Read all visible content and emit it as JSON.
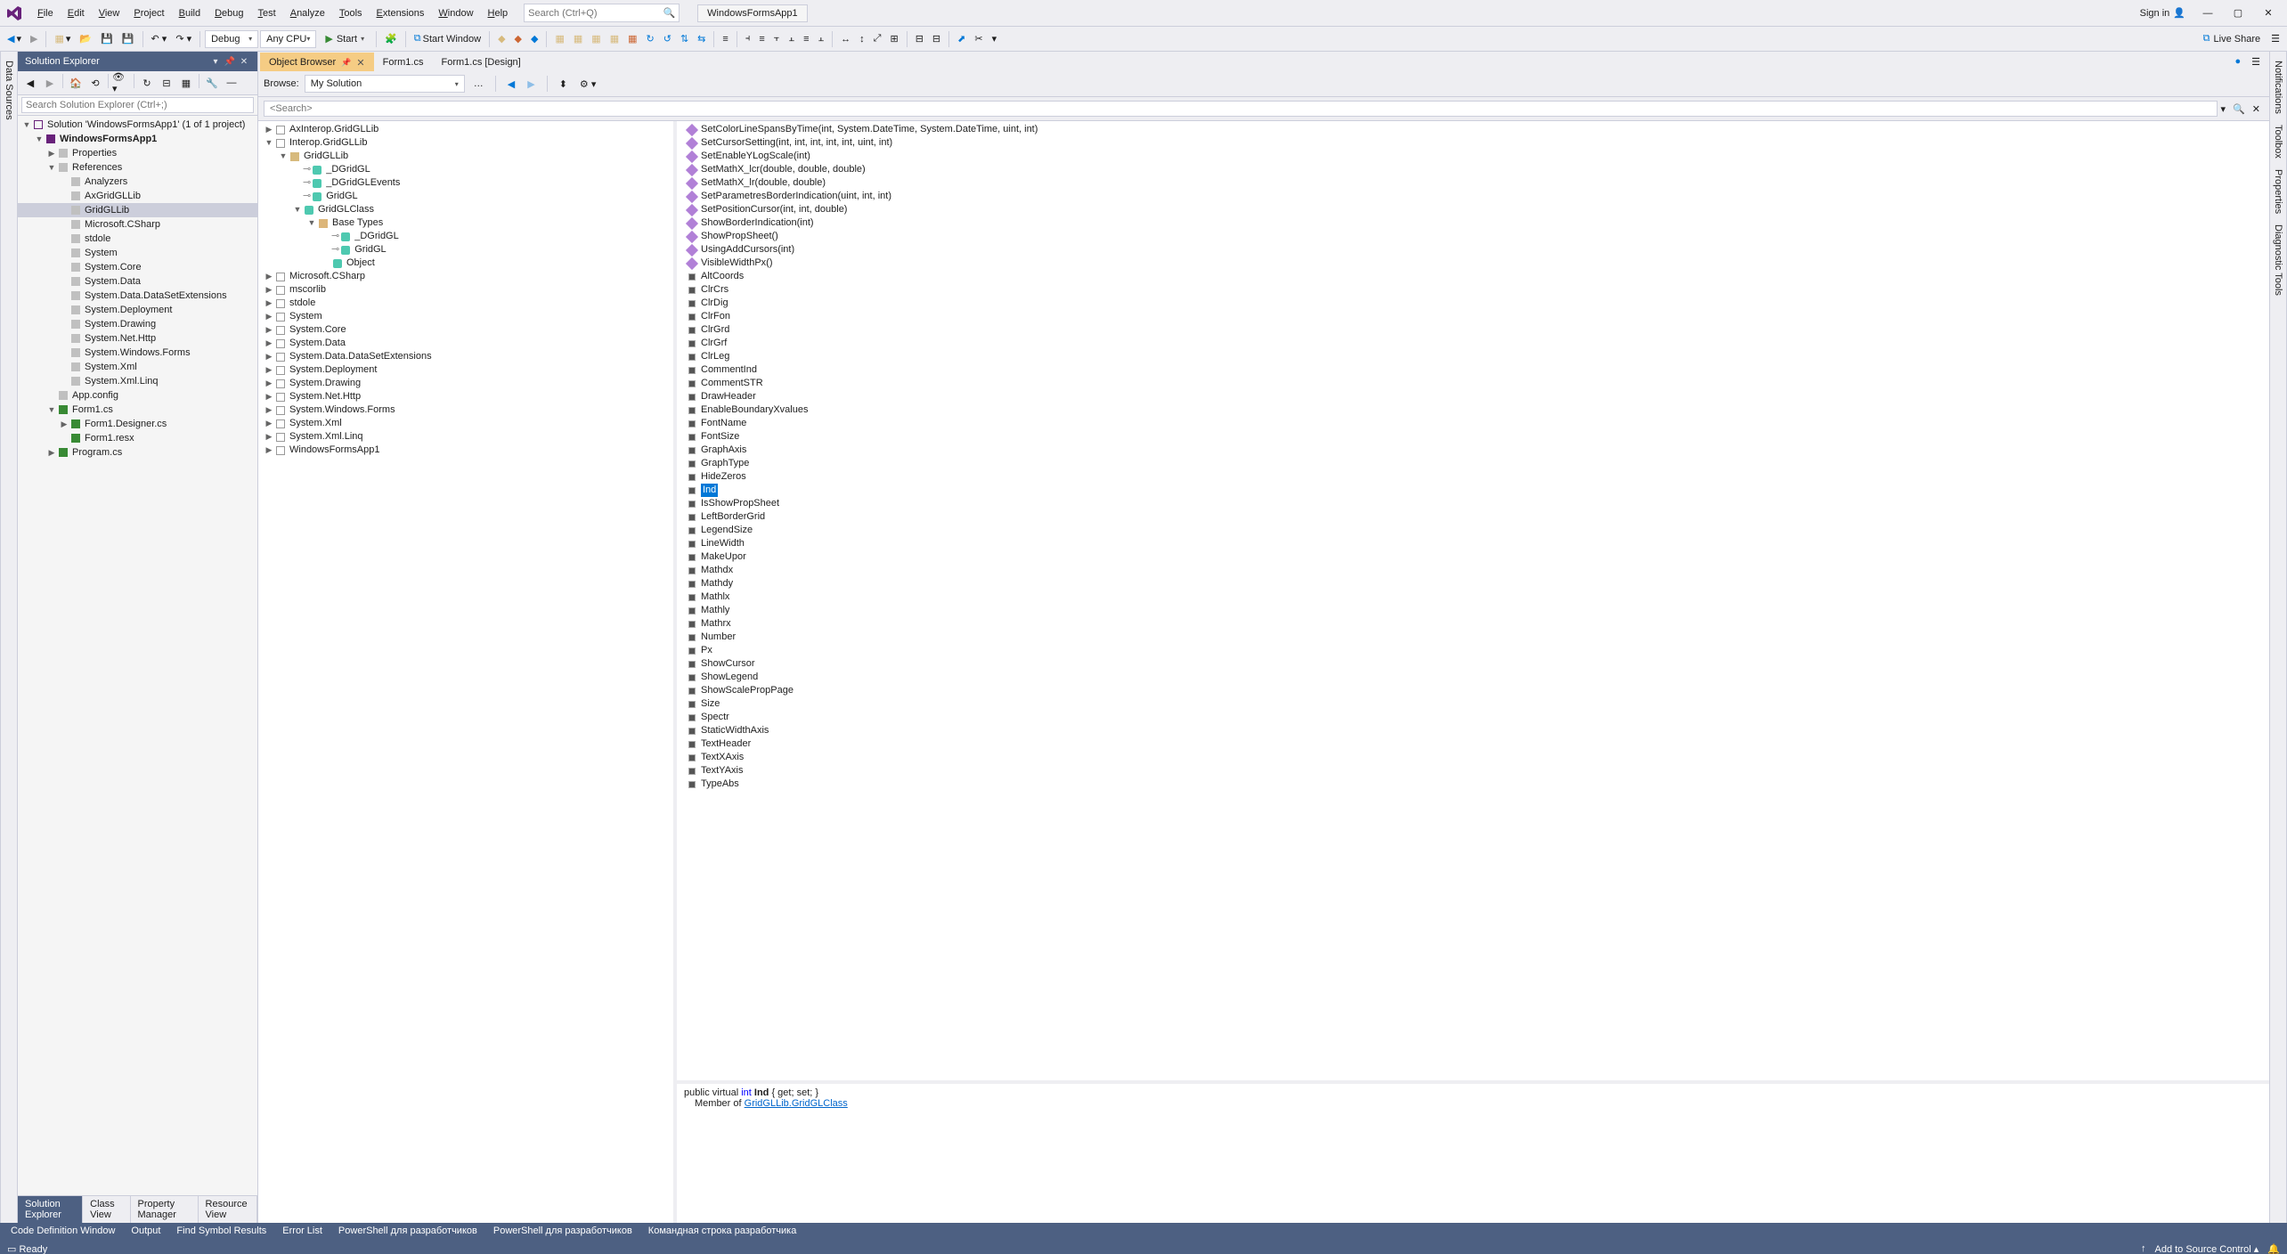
{
  "app_title": "WindowsFormsApp1",
  "menu": [
    "File",
    "Edit",
    "View",
    "Project",
    "Build",
    "Debug",
    "Test",
    "Analyze",
    "Tools",
    "Extensions",
    "Window",
    "Help"
  ],
  "search_placeholder": "Search (Ctrl+Q)",
  "signin": "Sign in",
  "toolbar": {
    "config": "Debug",
    "platform": "Any CPU",
    "start": "Start",
    "start_window": "Start Window",
    "liveshare": "Live Share"
  },
  "left_rail": [
    "Data Sources"
  ],
  "right_rail": [
    "Notifications",
    "Toolbox",
    "Properties",
    "Diagnostic Tools"
  ],
  "solution_explorer": {
    "title": "Solution Explorer",
    "search_placeholder": "Search Solution Explorer (Ctrl+;)",
    "bottom_tabs": [
      "Solution Explorer",
      "Class View",
      "Property Manager",
      "Resource View"
    ],
    "solution_label": "Solution 'WindowsFormsApp1' (1 of 1 project)",
    "project": "WindowsFormsApp1",
    "properties": "Properties",
    "references": "References",
    "refs": [
      "Analyzers",
      "AxGridGLLib",
      "GridGLLib",
      "Microsoft.CSharp",
      "stdole",
      "System",
      "System.Core",
      "System.Data",
      "System.Data.DataSetExtensions",
      "System.Deployment",
      "System.Drawing",
      "System.Net.Http",
      "System.Windows.Forms",
      "System.Xml",
      "System.Xml.Linq"
    ],
    "appconfig": "App.config",
    "form1": "Form1.cs",
    "form1_children": [
      "Form1.Designer.cs",
      "Form1.resx"
    ],
    "program": "Program.cs",
    "selected_ref": "GridGLLib"
  },
  "tabs": [
    {
      "label": "Object Browser",
      "active": true,
      "pinned": true
    },
    {
      "label": "Form1.cs",
      "active": false
    },
    {
      "label": "Form1.cs [Design]",
      "active": false
    }
  ],
  "object_browser": {
    "browse_label": "Browse:",
    "browse_value": "My Solution",
    "search_placeholder": "<Search>",
    "left_tree": {
      "top": [
        {
          "label": "AxInterop.GridGLLib",
          "depth": 0,
          "tw": "▶",
          "icon": "asm"
        },
        {
          "label": "Interop.GridGLLib",
          "depth": 0,
          "tw": "▼",
          "icon": "asm"
        },
        {
          "label": "GridGLLib",
          "depth": 1,
          "tw": "▼",
          "icon": "ns"
        },
        {
          "label": "_DGridGL",
          "depth": 2,
          "tw": "",
          "icon": "class",
          "pre": "⊸"
        },
        {
          "label": "_DGridGLEvents",
          "depth": 2,
          "tw": "",
          "icon": "class",
          "pre": "⊸"
        },
        {
          "label": "GridGL",
          "depth": 2,
          "tw": "",
          "icon": "class",
          "pre": "⊸"
        },
        {
          "label": "GridGLClass",
          "depth": 2,
          "tw": "▼",
          "icon": "class"
        },
        {
          "label": "Base Types",
          "depth": 3,
          "tw": "▼",
          "icon": "folder"
        },
        {
          "label": "_DGridGL",
          "depth": 4,
          "tw": "",
          "icon": "class",
          "pre": "⊸"
        },
        {
          "label": "GridGL",
          "depth": 4,
          "tw": "",
          "icon": "class",
          "pre": "⊸"
        },
        {
          "label": "Object",
          "depth": 4,
          "tw": "",
          "icon": "class"
        }
      ],
      "asms": [
        "Microsoft.CSharp",
        "mscorlib",
        "stdole",
        "System",
        "System.Core",
        "System.Data",
        "System.Data.DataSetExtensions",
        "System.Deployment",
        "System.Drawing",
        "System.Net.Http",
        "System.Windows.Forms",
        "System.Xml",
        "System.Xml.Linq",
        "WindowsFormsApp1"
      ]
    },
    "members": {
      "methods": [
        "SetColorLineSpansByTime(int, System.DateTime, System.DateTime, uint, int)",
        "SetCursorSetting(int, int, int, int, int, uint, int)",
        "SetEnableYLogScale(int)",
        "SetMathX_lcr(double, double, double)",
        "SetMathX_lr(double, double)",
        "SetParametresBorderIndication(uint, int, int)",
        "SetPositionCursor(int, int, double)",
        "ShowBorderIndication(int)",
        "ShowPropSheet()",
        "UsingAddCursors(int)",
        "VisibleWidthPx()"
      ],
      "properties": [
        "AltCoords",
        "ClrCrs",
        "ClrDig",
        "ClrFon",
        "ClrGrd",
        "ClrGrf",
        "ClrLeg",
        "CommentInd",
        "CommentSTR",
        "DrawHeader",
        "EnableBoundaryXvalues",
        "FontName",
        "FontSize",
        "GraphAxis",
        "GraphType",
        "HideZeros",
        "Ind",
        "IsShowPropSheet",
        "LeftBorderGrid",
        "LegendSize",
        "LineWidth",
        "MakeUpor",
        "Mathdx",
        "Mathdy",
        "Mathlx",
        "Mathly",
        "Mathrx",
        "Number",
        "Px",
        "ShowCursor",
        "ShowLegend",
        "ShowScalePropPage",
        "Size",
        "Spectr",
        "StaticWidthAxis",
        "TextHeader",
        "TextXAxis",
        "TextYAxis",
        "TypeAbs"
      ],
      "selected": "Ind"
    },
    "description": {
      "prefix": "public virtual ",
      "type": "int",
      "name": "Ind",
      "suffix": " { get; set; }",
      "member_of_label": "Member of ",
      "member_of_link": "GridGLLib.GridGLClass"
    }
  },
  "tool_tabs": [
    "Code Definition Window",
    "Output",
    "Find Symbol Results",
    "Error List",
    "PowerShell для разработчиков",
    "PowerShell для разработчиков",
    "Командная строка разработчика"
  ],
  "status": {
    "ready": "Ready",
    "source_control": "Add to Source Control"
  }
}
